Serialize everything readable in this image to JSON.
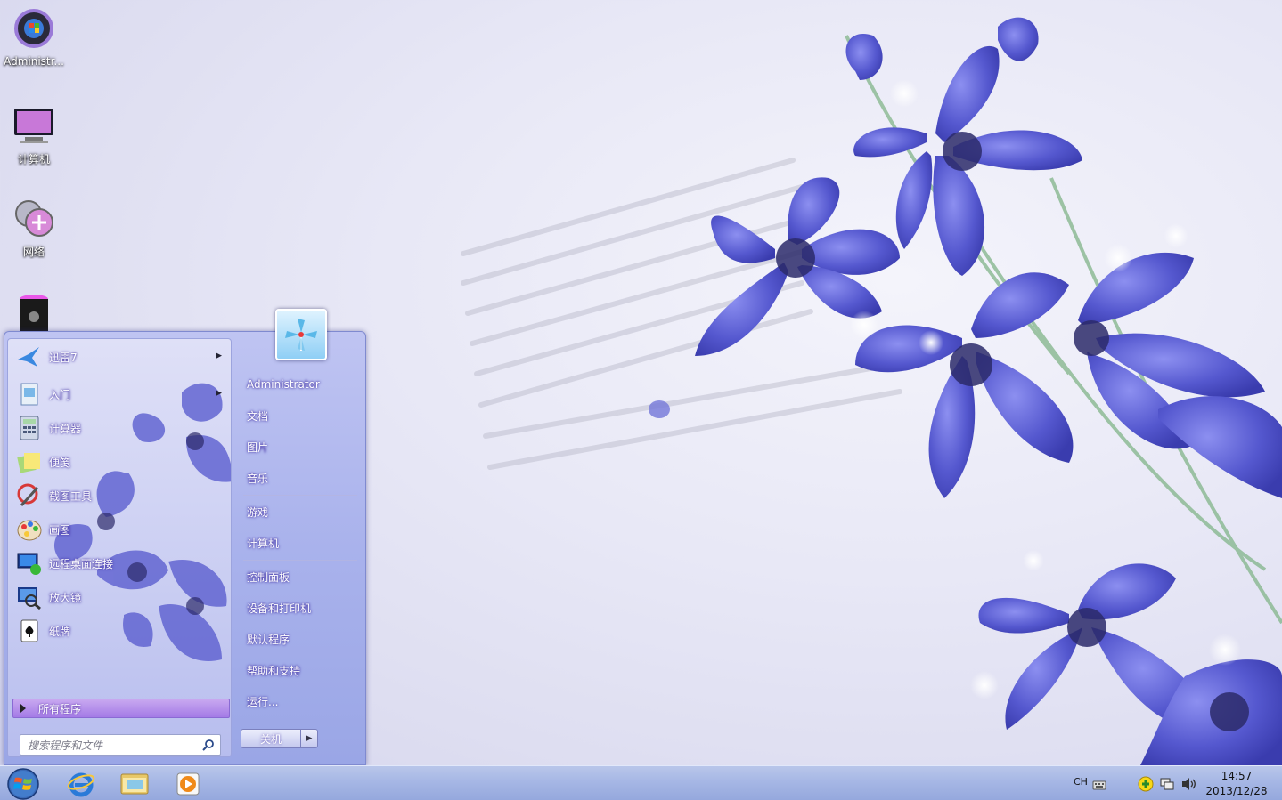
{
  "desktop": {
    "icons": [
      {
        "label": "Administr..."
      },
      {
        "label": "计算机"
      },
      {
        "label": "网络"
      },
      {
        "label": ""
      }
    ]
  },
  "start_menu": {
    "programs": [
      {
        "label": "迅雷7",
        "has_submenu": true
      },
      {
        "label": "入门",
        "has_submenu": true
      },
      {
        "label": "计算器",
        "has_submenu": false
      },
      {
        "label": "便笺",
        "has_submenu": false
      },
      {
        "label": "截图工具",
        "has_submenu": false
      },
      {
        "label": "画图",
        "has_submenu": false
      },
      {
        "label": "远程桌面连接",
        "has_submenu": false
      },
      {
        "label": "放大镜",
        "has_submenu": false
      },
      {
        "label": "纸牌",
        "has_submenu": false
      }
    ],
    "all_programs": "所有程序",
    "search_placeholder": "搜索程序和文件",
    "right_items": [
      "Administrator",
      "文档",
      "图片",
      "音乐",
      "游戏",
      "计算机",
      "控制面板",
      "设备和打印机",
      "默认程序",
      "帮助和支持",
      "运行..."
    ],
    "shutdown_label": "关机"
  },
  "taskbar": {
    "pinned": [
      "internet-explorer",
      "windows-explorer",
      "media-player"
    ],
    "tray": {
      "language": "CH",
      "time": "14:57",
      "date": "2013/12/28"
    }
  },
  "colors": {
    "accent": "#a47be6",
    "flower": "#5a5ccf",
    "taskbar": "#a6b7e5"
  }
}
